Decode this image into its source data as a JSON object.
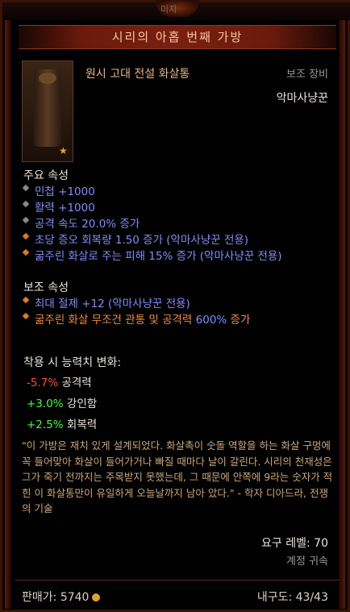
{
  "header": {
    "top_partial": "미지",
    "title": "시리의 아홉 번째 가방"
  },
  "item": {
    "name": "원시 고대 전설 화살통",
    "slot": "보조 장비",
    "class": "악마사냥꾼"
  },
  "primary": {
    "heading": "주요 속성",
    "lines": [
      {
        "text": "민첩 +1000",
        "color": "blue",
        "bullet": "gray"
      },
      {
        "text": "활력 +1000",
        "color": "blue",
        "bullet": "gray"
      },
      {
        "text": "공격 속도 20.0% 증가",
        "color": "blue",
        "bullet": "gray"
      },
      {
        "text": "초당 증오 회복량 1.50 증가 (악마사냥꾼 전용)",
        "color": "blue",
        "bullet": "orange"
      },
      {
        "text": "굶주린 화살로 주는 피해 15% 증가 (악마사냥꾼 전용)",
        "color": "blue",
        "bullet": "orange"
      }
    ]
  },
  "secondary": {
    "heading": "보조 속성",
    "line1": "최대 절제 +12 (악마사냥꾼 전용)",
    "line2_a": "굶주린 화살 무조건 관통 및 공격력 ",
    "line2_b": "600%",
    "line2_c": " 증가"
  },
  "changes": {
    "heading": "착용 시 능력치 변화:",
    "rows": [
      {
        "value": "-5.7%",
        "label": " 공격력",
        "sign": "neg"
      },
      {
        "value": "+3.0%",
        "label": " 강인함",
        "sign": "pos"
      },
      {
        "value": "+2.5%",
        "label": " 회복력",
        "sign": "pos"
      }
    ]
  },
  "flavor": "\"이 가방은 재치 있게 설계되었다. 화살촉이 숫돌 역할을 하는 화살 구멍에 꼭 들어맞아 화살이 들어가거나 빠질 때마다 날이 갈린다. 시리의 천재성은 그가 죽기 전까지는 주목받지 못했는데, 그 때문에 안쪽에 9라는 숫자가 적힌 이 화살통만이 유일하게 오늘날까지 남아 았다.\" - 학자 디아드라, 전쟁의 기술",
  "requirement": "요구 레벨: 70",
  "account": "계정 귀속",
  "footer": {
    "price_label": "판매가: ",
    "price": "5740",
    "durability": "내구도: 43/43"
  }
}
